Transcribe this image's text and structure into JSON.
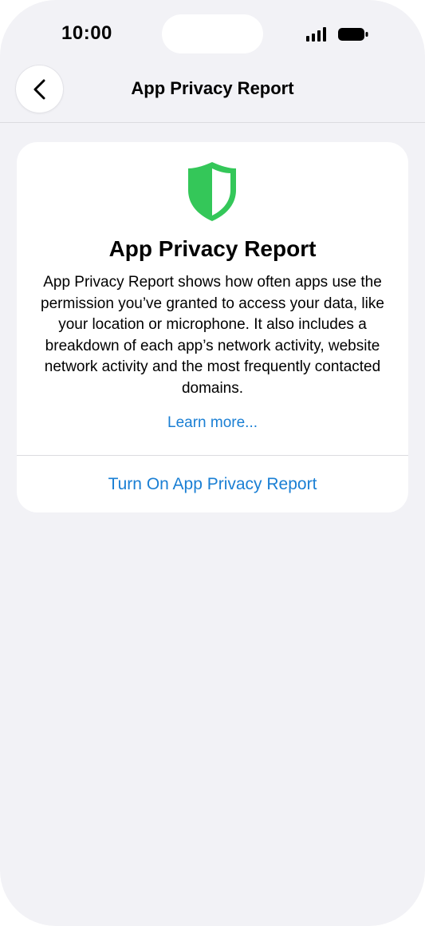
{
  "status_bar": {
    "time": "10:00",
    "icons": [
      "signal-icon",
      "battery-icon"
    ]
  },
  "nav": {
    "back_icon": "chevron-left-icon",
    "title": "App Privacy Report"
  },
  "card": {
    "icon": "shield-icon",
    "title": "App Privacy Report",
    "description": "App Privacy Report shows how often apps use the permission you’ve granted to access your data, like your location or microphone. It also includes a breakdown of each app’s network activity, website network activity and the most frequently contacted domains.",
    "learn_more": "Learn more...",
    "action_label": "Turn On App Privacy Report"
  },
  "colors": {
    "accent": "#1a7fd4",
    "shield_green": "#34c759",
    "background": "#f2f2f6",
    "card": "#ffffff"
  }
}
